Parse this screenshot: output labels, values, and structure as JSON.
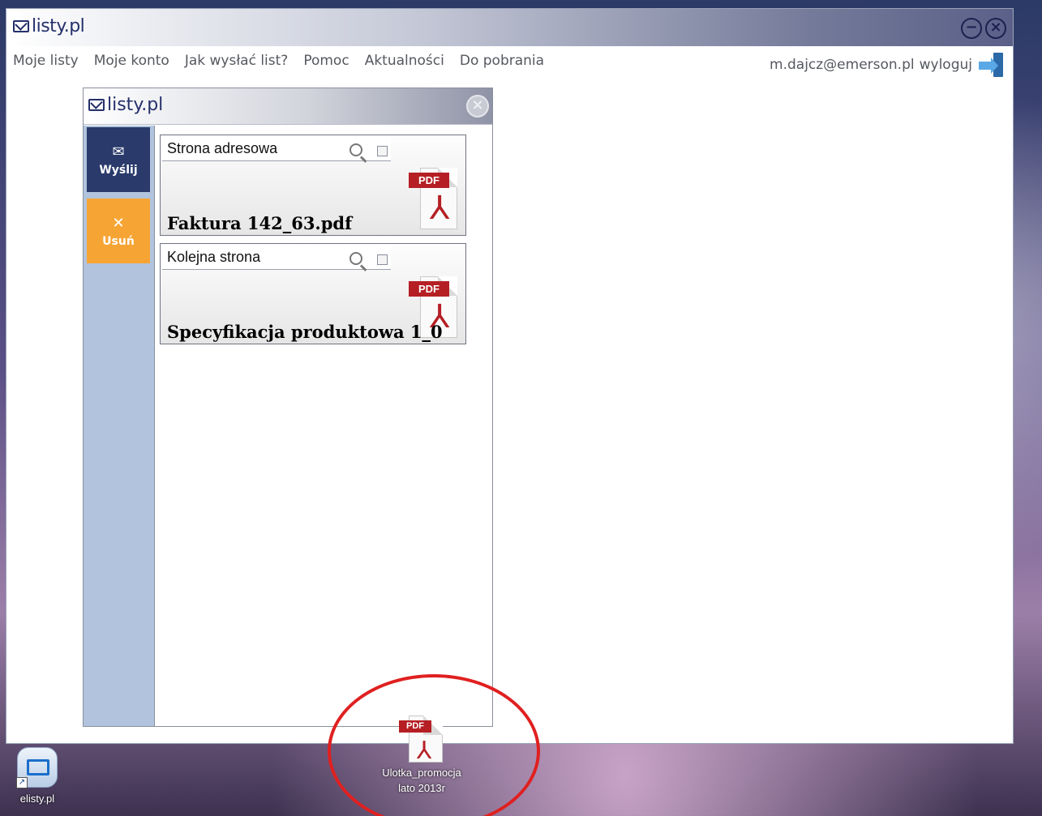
{
  "app": {
    "logo": "listy.pl",
    "min_symbol": "−",
    "close_symbol": "×"
  },
  "menu": {
    "items": [
      "Moje listy",
      "Moje konto",
      "Jak wysłać list?",
      "Pomoc",
      "Aktualności",
      "Do pobrania"
    ]
  },
  "user": {
    "email": "m.dajcz@emerson.pl",
    "logout": "wyloguj"
  },
  "panel": {
    "logo": "listy.pl",
    "close_symbol": "×",
    "actions": [
      {
        "label": "Wyślij",
        "icon": "send-icon",
        "glyph": "✉"
      },
      {
        "label": "Usuń",
        "icon": "delete-icon",
        "glyph": "✕"
      }
    ],
    "files": [
      {
        "header": "Strona adresowa",
        "filename": "Faktura 142_63.pdf",
        "type_label": "PDF"
      },
      {
        "header": "Kolejna strona",
        "filename": "Specyfikacja produktowa 1_0",
        "type_label": "PDF"
      }
    ]
  },
  "desktop": {
    "shortcut_label": "elisty.pl",
    "file_label_line1": "Ulotka_promocja",
    "file_label_line2": "lato 2013r",
    "file_type_label": "PDF"
  },
  "colors": {
    "brand_navy": "#25306b",
    "send_button": "#293a6b",
    "delete_button": "#f6a535",
    "sidebar": "#b2c4dd",
    "pdf_red": "#b51f24",
    "highlight_circle": "#e02020"
  }
}
